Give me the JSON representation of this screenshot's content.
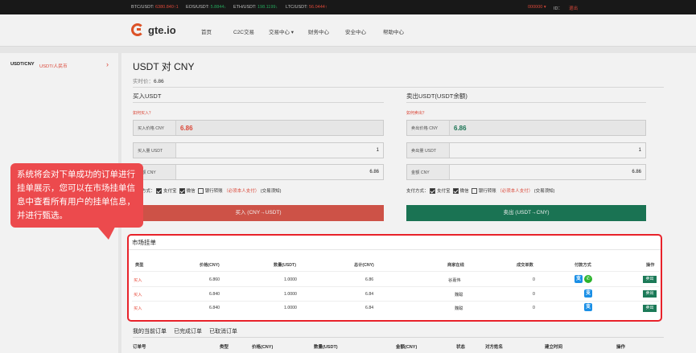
{
  "ticker": {
    "items": [
      {
        "pair": "BTC/USDT:",
        "value": "6380.840↑1",
        "up": false
      },
      {
        "pair": "EOS/USDT:",
        "value": "5.8844↓",
        "up": true
      },
      {
        "pair": "ETH/USDT:",
        "value": "198.1199↓",
        "up": true
      },
      {
        "pair": "LTC/USDT:",
        "value": "56.0444↑",
        "up": false
      }
    ],
    "user": "000000 ▾",
    "id_label": "ID：",
    "logout": "退出"
  },
  "nav": {
    "logo": "gte.io",
    "items": [
      "首页",
      "C2C交易",
      "交易中心 ▾",
      "财务中心",
      "安全中心",
      "帮助中心"
    ]
  },
  "sidebar": {
    "pair": "USDT/CNY",
    "pair_desc": "USDT/人民币",
    "arrow": "›"
  },
  "main": {
    "title": "USDT 对 CNY",
    "price_label": "实时价：",
    "price_value": "6.86"
  },
  "buy": {
    "title": "买入USDT",
    "how_link": "如何买入？",
    "price_label": "买入价格 CNY",
    "price_value": "6.86",
    "qty_label": "买入量 USDT",
    "qty_value": "1",
    "amount_label": "金额 CNY",
    "amount_value": "6.86",
    "pay_label": "支付方式：",
    "alipay": "支付宝",
    "wechat": "微信",
    "bank": "银行转账",
    "note": "（必须本人支付）",
    "period": "(交易须知)",
    "button": "买入 (CNY→USDT)"
  },
  "sell": {
    "title": "卖出USDT(USDT余额)",
    "how_link": "如何卖出？",
    "price_label": "卖出价格 CNY",
    "price_value": "6.86",
    "qty_label": "卖出量 USDT",
    "qty_value": "1",
    "amount_label": "金额 CNY",
    "amount_value": "6.86",
    "pay_label": "支付方式：",
    "alipay": "支付宝",
    "wechat": "微信",
    "bank": "银行转账",
    "note": "（必须本人支付）",
    "period": "(交易须知)",
    "button": "卖出 (USDT→CNY)"
  },
  "market": {
    "title": "市场挂单",
    "headers": [
      "类型",
      "价格(CNY)",
      "数量(USDT)",
      "总计(CNY)",
      "商家在线",
      "成交单数",
      "付款方式",
      "操作"
    ],
    "rows": [
      {
        "type": "买入",
        "price": "6.860",
        "qty": "1.0000",
        "total": "6.86",
        "merchant": "谷嘉伟",
        "deals": "0",
        "pay": [
          "alipay",
          "wechat"
        ],
        "action": "卖出"
      },
      {
        "type": "买入",
        "price": "6.840",
        "qty": "1.0000",
        "total": "6.84",
        "merchant": "魏聪",
        "deals": "0",
        "pay": [
          "alipay"
        ],
        "action": "卖出"
      },
      {
        "type": "买入",
        "price": "6.840",
        "qty": "1.0000",
        "total": "6.84",
        "merchant": "魏聪",
        "deals": "0",
        "pay": [
          "alipay"
        ],
        "action": "卖出"
      }
    ],
    "alipay_glyph": "支",
    "wechat_glyph": "✆"
  },
  "orders": {
    "tabs": [
      "我的当前订单",
      "已完成订单",
      "已取消订单"
    ],
    "headers": [
      "订单号",
      "类型",
      "价格(CNY)",
      "数量(USDT)",
      "金额(CNY)",
      "状态",
      "对方姓名",
      "建立时间",
      "操作"
    ]
  },
  "callout": {
    "text": "系统将会对下单成功的订单进行挂单展示，您可以在市场挂单信息中查看所有用户的挂单信息，并进行甄选。"
  },
  "colors": {
    "accent_red": "#e74c3c",
    "buy_button": "#d9574b",
    "sell_button": "#1c7a58",
    "callout": "#ec4a4d",
    "highlight_border": "#e8222a"
  }
}
